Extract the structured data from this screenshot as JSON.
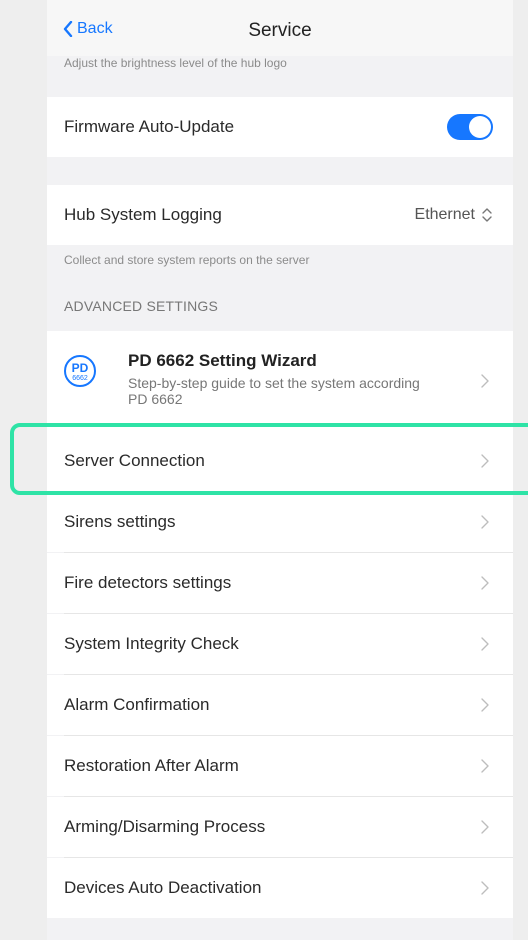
{
  "header": {
    "back_label": "Back",
    "title": "Service"
  },
  "brightness_note": "Adjust the brightness level of the hub logo",
  "firmware": {
    "label": "Firmware Auto-Update",
    "enabled": true
  },
  "hub_logging": {
    "label": "Hub System Logging",
    "value": "Ethernet",
    "note": "Collect and store system reports on the server"
  },
  "advanced_header": "ADVANCED SETTINGS",
  "wizard": {
    "logo_top": "PD",
    "logo_bottom": "6662",
    "title": "PD 6662 Setting Wizard",
    "desc": "Step-by-step guide to set the system according PD 6662"
  },
  "menu": [
    "Server Connection",
    "Sirens settings",
    "Fire detectors settings",
    "System Integrity Check",
    "Alarm Confirmation",
    "Restoration After Alarm",
    "Arming/Disarming Process",
    "Devices Auto Deactivation"
  ],
  "colors": {
    "accent": "#1677ff",
    "highlight": "#2ee3a6"
  }
}
